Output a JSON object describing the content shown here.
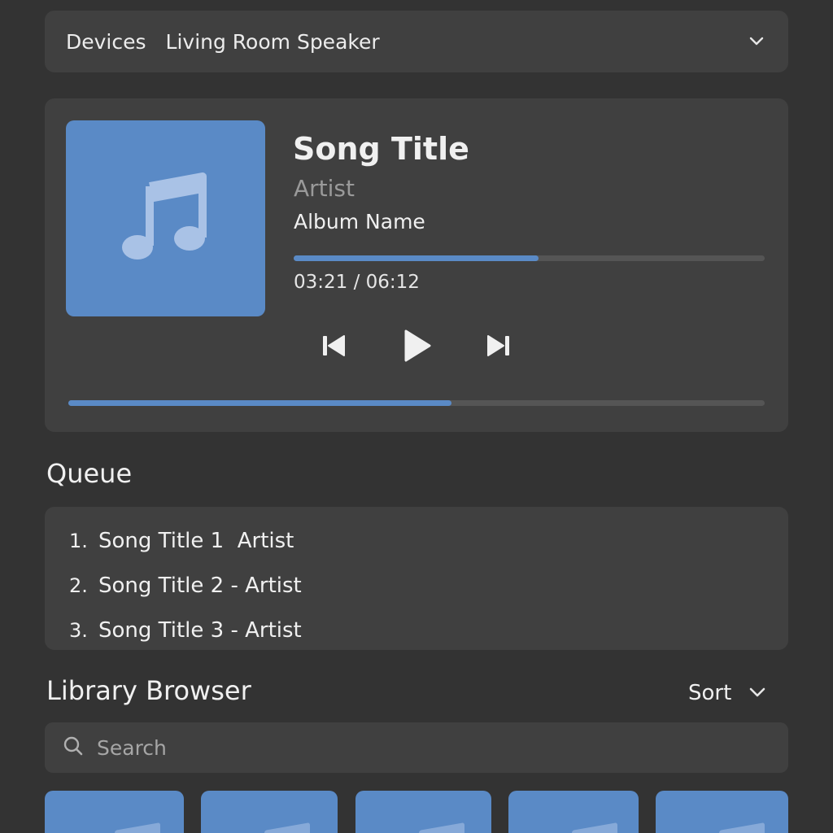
{
  "devices": {
    "label": "Devices",
    "selected": "Living Room Speaker"
  },
  "now_playing": {
    "title": "Song Title",
    "artist": "Artist",
    "album": "Album Name",
    "time_readout": "03:21 / 06:12",
    "track_progress_fraction": 0.52,
    "bottom_progress_fraction": 0.55,
    "icons": {
      "art": "music-note-icon",
      "prev": "skip-previous-icon",
      "play": "play-icon",
      "next": "skip-next-icon"
    }
  },
  "queue": {
    "heading": "Queue",
    "items": [
      {
        "num": "1.",
        "text": "Song Title 1  Artist"
      },
      {
        "num": "2.",
        "text": "Song Title 2 - Artist"
      },
      {
        "num": "3.",
        "text": "Song Title 3 - Artist"
      }
    ]
  },
  "library": {
    "heading": "Library Browser",
    "sort_label": "Sort",
    "search_placeholder": "Search",
    "tile_count": 5
  },
  "colors": {
    "accent": "#5a8ac6",
    "background": "#333333",
    "card": "#404040",
    "muted_text": "#9a9a9a"
  }
}
